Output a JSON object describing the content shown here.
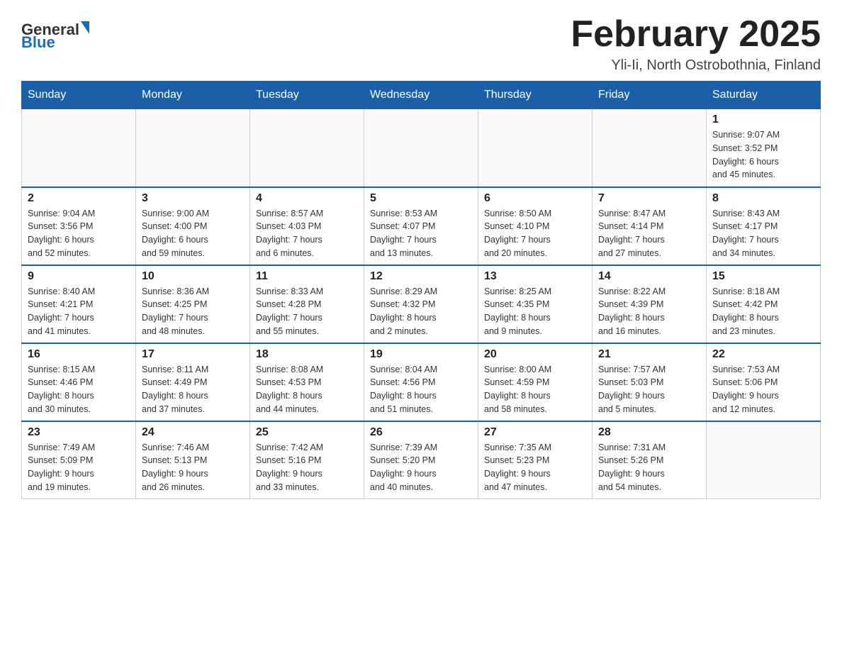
{
  "header": {
    "logo_general": "General",
    "logo_blue": "Blue",
    "title": "February 2025",
    "subtitle": "Yli-Ii, North Ostrobothnia, Finland"
  },
  "days_of_week": [
    "Sunday",
    "Monday",
    "Tuesday",
    "Wednesday",
    "Thursday",
    "Friday",
    "Saturday"
  ],
  "weeks": [
    [
      {
        "day": "",
        "info": ""
      },
      {
        "day": "",
        "info": ""
      },
      {
        "day": "",
        "info": ""
      },
      {
        "day": "",
        "info": ""
      },
      {
        "day": "",
        "info": ""
      },
      {
        "day": "",
        "info": ""
      },
      {
        "day": "1",
        "info": "Sunrise: 9:07 AM\nSunset: 3:52 PM\nDaylight: 6 hours\nand 45 minutes."
      }
    ],
    [
      {
        "day": "2",
        "info": "Sunrise: 9:04 AM\nSunset: 3:56 PM\nDaylight: 6 hours\nand 52 minutes."
      },
      {
        "day": "3",
        "info": "Sunrise: 9:00 AM\nSunset: 4:00 PM\nDaylight: 6 hours\nand 59 minutes."
      },
      {
        "day": "4",
        "info": "Sunrise: 8:57 AM\nSunset: 4:03 PM\nDaylight: 7 hours\nand 6 minutes."
      },
      {
        "day": "5",
        "info": "Sunrise: 8:53 AM\nSunset: 4:07 PM\nDaylight: 7 hours\nand 13 minutes."
      },
      {
        "day": "6",
        "info": "Sunrise: 8:50 AM\nSunset: 4:10 PM\nDaylight: 7 hours\nand 20 minutes."
      },
      {
        "day": "7",
        "info": "Sunrise: 8:47 AM\nSunset: 4:14 PM\nDaylight: 7 hours\nand 27 minutes."
      },
      {
        "day": "8",
        "info": "Sunrise: 8:43 AM\nSunset: 4:17 PM\nDaylight: 7 hours\nand 34 minutes."
      }
    ],
    [
      {
        "day": "9",
        "info": "Sunrise: 8:40 AM\nSunset: 4:21 PM\nDaylight: 7 hours\nand 41 minutes."
      },
      {
        "day": "10",
        "info": "Sunrise: 8:36 AM\nSunset: 4:25 PM\nDaylight: 7 hours\nand 48 minutes."
      },
      {
        "day": "11",
        "info": "Sunrise: 8:33 AM\nSunset: 4:28 PM\nDaylight: 7 hours\nand 55 minutes."
      },
      {
        "day": "12",
        "info": "Sunrise: 8:29 AM\nSunset: 4:32 PM\nDaylight: 8 hours\nand 2 minutes."
      },
      {
        "day": "13",
        "info": "Sunrise: 8:25 AM\nSunset: 4:35 PM\nDaylight: 8 hours\nand 9 minutes."
      },
      {
        "day": "14",
        "info": "Sunrise: 8:22 AM\nSunset: 4:39 PM\nDaylight: 8 hours\nand 16 minutes."
      },
      {
        "day": "15",
        "info": "Sunrise: 8:18 AM\nSunset: 4:42 PM\nDaylight: 8 hours\nand 23 minutes."
      }
    ],
    [
      {
        "day": "16",
        "info": "Sunrise: 8:15 AM\nSunset: 4:46 PM\nDaylight: 8 hours\nand 30 minutes."
      },
      {
        "day": "17",
        "info": "Sunrise: 8:11 AM\nSunset: 4:49 PM\nDaylight: 8 hours\nand 37 minutes."
      },
      {
        "day": "18",
        "info": "Sunrise: 8:08 AM\nSunset: 4:53 PM\nDaylight: 8 hours\nand 44 minutes."
      },
      {
        "day": "19",
        "info": "Sunrise: 8:04 AM\nSunset: 4:56 PM\nDaylight: 8 hours\nand 51 minutes."
      },
      {
        "day": "20",
        "info": "Sunrise: 8:00 AM\nSunset: 4:59 PM\nDaylight: 8 hours\nand 58 minutes."
      },
      {
        "day": "21",
        "info": "Sunrise: 7:57 AM\nSunset: 5:03 PM\nDaylight: 9 hours\nand 5 minutes."
      },
      {
        "day": "22",
        "info": "Sunrise: 7:53 AM\nSunset: 5:06 PM\nDaylight: 9 hours\nand 12 minutes."
      }
    ],
    [
      {
        "day": "23",
        "info": "Sunrise: 7:49 AM\nSunset: 5:09 PM\nDaylight: 9 hours\nand 19 minutes."
      },
      {
        "day": "24",
        "info": "Sunrise: 7:46 AM\nSunset: 5:13 PM\nDaylight: 9 hours\nand 26 minutes."
      },
      {
        "day": "25",
        "info": "Sunrise: 7:42 AM\nSunset: 5:16 PM\nDaylight: 9 hours\nand 33 minutes."
      },
      {
        "day": "26",
        "info": "Sunrise: 7:39 AM\nSunset: 5:20 PM\nDaylight: 9 hours\nand 40 minutes."
      },
      {
        "day": "27",
        "info": "Sunrise: 7:35 AM\nSunset: 5:23 PM\nDaylight: 9 hours\nand 47 minutes."
      },
      {
        "day": "28",
        "info": "Sunrise: 7:31 AM\nSunset: 5:26 PM\nDaylight: 9 hours\nand 54 minutes."
      },
      {
        "day": "",
        "info": ""
      }
    ]
  ]
}
